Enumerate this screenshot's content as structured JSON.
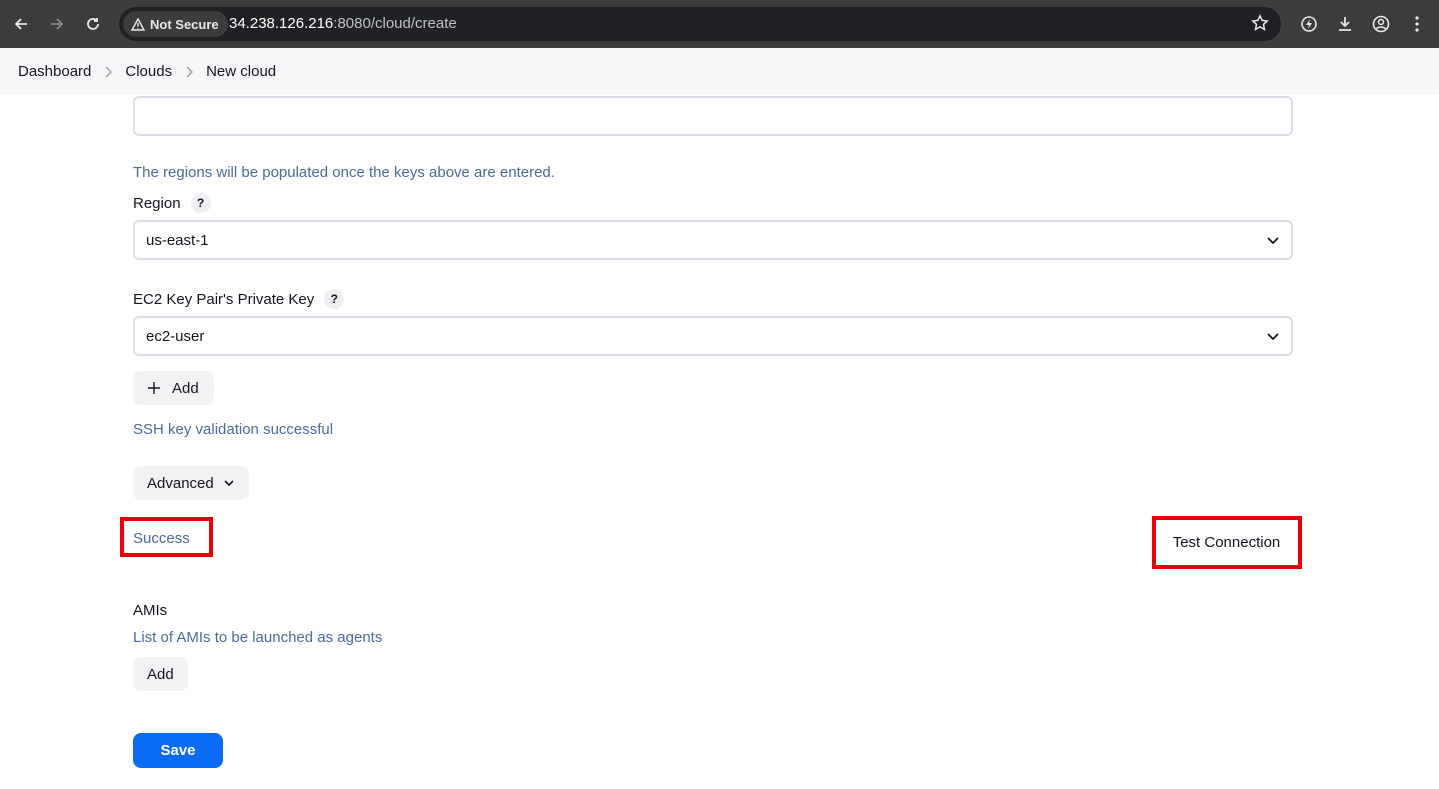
{
  "browser": {
    "security_label": "Not Secure",
    "url_host": "34.238.126.216",
    "url_path": ":8080/cloud/create"
  },
  "breadcrumbs": [
    "Dashboard",
    "Clouds",
    "New cloud"
  ],
  "form": {
    "regions_help": "The regions will be populated once the keys above are entered.",
    "region_label": "Region",
    "region_help_badge": "?",
    "region_value": "us-east-1",
    "key_label": "EC2 Key Pair's Private Key",
    "key_help_badge": "?",
    "key_value": "ec2-user",
    "add_label": "Add",
    "ssh_status": "SSH key validation successful",
    "advanced_label": "Advanced",
    "connection_status": "Success",
    "test_connection_label": "Test Connection",
    "amis_label": "AMIs",
    "amis_help": "List of AMIs to be launched as agents",
    "amis_add_label": "Add",
    "save_label": "Save"
  },
  "colors": {
    "highlight": "#e8000b",
    "primary": "#0b6bf2",
    "help_text": "#4b6a99"
  }
}
